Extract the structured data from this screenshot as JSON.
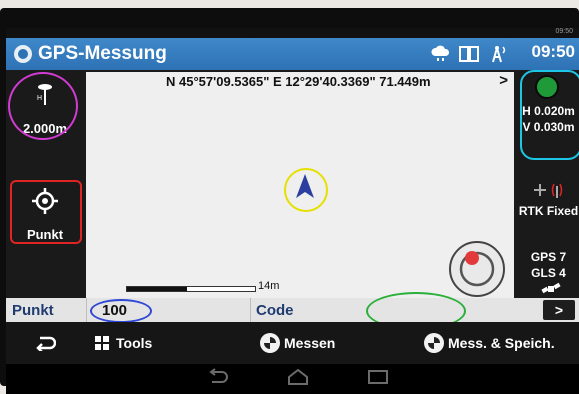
{
  "window": {
    "title": "GPS-Messung",
    "clock": "09:50",
    "status_clock_small": "09:50"
  },
  "map": {
    "coordinates": "N 45°57'09.5365\" E 12°29'40.3369\" 71.449m",
    "coord_arrow": ">",
    "scale_label": "14m"
  },
  "left_panel": {
    "antenna_height": "2.000m",
    "point_button_label": "Punkt"
  },
  "right_panel": {
    "h_accuracy": "H 0.020m",
    "v_accuracy": "V 0.030m",
    "fix_status": "RTK Fixed",
    "gps_count": "GPS 7",
    "gls_count": "GLS 4"
  },
  "input_row": {
    "punkt_label": "Punkt",
    "punkt_value": "100",
    "code_label": "Code",
    "code_value": "",
    "next_label": ">"
  },
  "action_bar": {
    "back_icon": "back-arrow-icon",
    "tools_label": "Tools",
    "measure_label": "Messen",
    "measure_save_label": "Mess. & Speich."
  },
  "colors": {
    "title_bar": "#2d72b4",
    "fix_indicator": "#1f9a38",
    "position_marker": "#2a3fa0",
    "highlight_magenta": "#d03bd1",
    "highlight_red": "#e02424",
    "highlight_yellow": "#e6e000",
    "highlight_cyan": "#1ec6e6",
    "highlight_blue": "#3048d6",
    "highlight_green": "#29b03a"
  }
}
